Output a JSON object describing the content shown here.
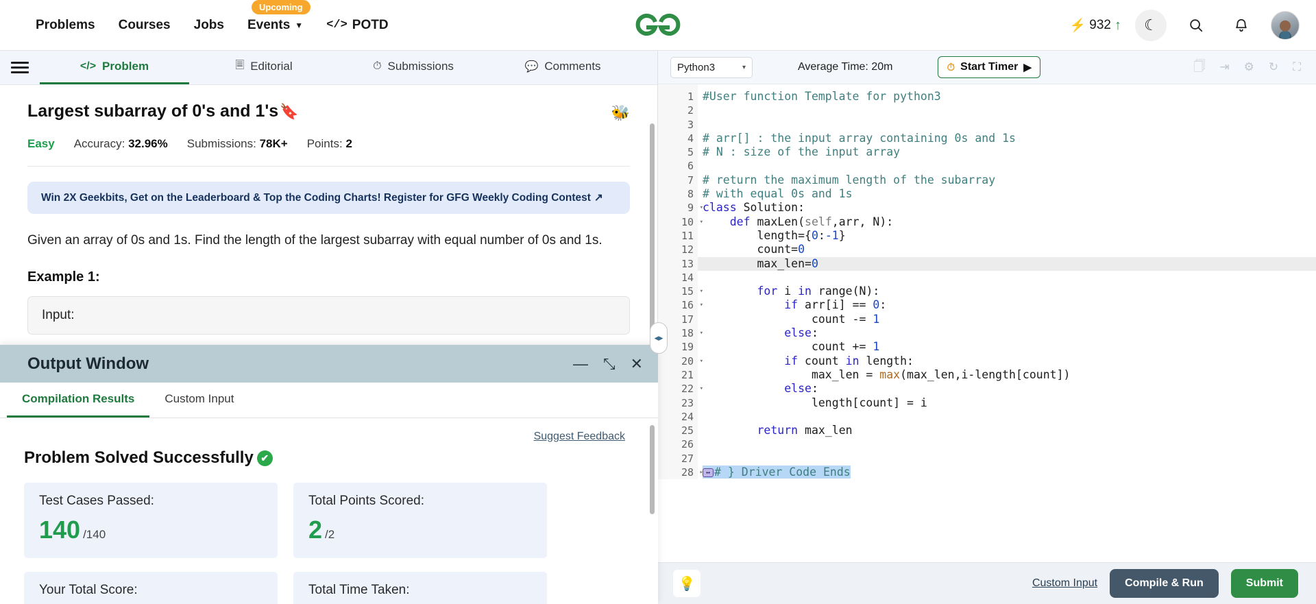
{
  "topnav": {
    "items": [
      {
        "label": "Problems",
        "has_chevron": false,
        "badge": null
      },
      {
        "label": "Courses",
        "has_chevron": false,
        "badge": null
      },
      {
        "label": "Jobs",
        "has_chevron": false,
        "badge": null
      },
      {
        "label": "Events",
        "has_chevron": true,
        "badge": "Upcoming"
      },
      {
        "label": "POTD",
        "has_chevron": false,
        "badge": null
      }
    ],
    "potd_icon": "</>",
    "logo": "gfg-logo",
    "streak_value": "932",
    "streak_icon": "bolt-icon",
    "streak_arrow": "↑",
    "dark_mode_icon": "☾",
    "search_icon": "search-icon",
    "bell_icon": "bell-icon",
    "avatar": "user-avatar"
  },
  "left": {
    "tabs": [
      {
        "label": "Problem",
        "icon": "</>",
        "active": true
      },
      {
        "label": "Editorial",
        "icon": "🗎",
        "active": false
      },
      {
        "label": "Submissions",
        "icon": "◴",
        "active": false
      },
      {
        "label": "Comments",
        "icon": "🗩",
        "active": false
      }
    ],
    "problem": {
      "title": "Largest subarray of 0's and 1's",
      "bookmark_icon": "🔖",
      "bug_icon": "bug-icon",
      "difficulty": "Easy",
      "accuracy_label": "Accuracy:",
      "accuracy_value": "32.96%",
      "submissions_label": "Submissions:",
      "submissions_value": "78K+",
      "points_label": "Points:",
      "points_value": "2",
      "promo_text": "Win 2X Geekbits, Get on the Leaderboard & Top the Coding Charts! Register for GFG Weekly Coding Contest",
      "promo_external_icon": "↗",
      "description": "Given an array of 0s and 1s. Find the length of the largest subarray with equal number of 0s and 1s.",
      "example_heading": "Example 1:",
      "example_input_label": "Input:"
    }
  },
  "output_window": {
    "title": "Output Window",
    "minimize_icon": "—",
    "expand_icon": "⤡",
    "close_icon": "✕",
    "tabs": [
      {
        "label": "Compilation Results",
        "active": true
      },
      {
        "label": "Custom Input",
        "active": false
      }
    ],
    "suggest_feedback": "Suggest Feedback",
    "status": "Problem Solved Successfully",
    "status_icon": "✔",
    "cards": [
      {
        "label": "Test Cases Passed:",
        "value": "140",
        "suffix": "/140"
      },
      {
        "label": "Total Points Scored:",
        "value": "2",
        "suffix": "/2"
      },
      {
        "label": "Your Total Score:",
        "value": "",
        "suffix": ""
      },
      {
        "label": "Total Time Taken:",
        "value": "",
        "suffix": ""
      }
    ]
  },
  "editor": {
    "language": "Python3",
    "language_chevron": "▾",
    "average_time": "Average Time: 20m",
    "timer_label": "Start Timer",
    "timer_clock_icon": "⏱",
    "timer_play_icon": "▶",
    "toolbar_icons": [
      "copy-icon",
      "sign-in-icon",
      "gear-icon",
      "reset-icon",
      "fullscreen-icon"
    ],
    "lines": [
      {
        "n": 1,
        "fold": "",
        "hl": false,
        "tokens": [
          {
            "t": "#User function Template for python3",
            "c": "com"
          }
        ]
      },
      {
        "n": 2,
        "fold": "",
        "hl": false,
        "tokens": []
      },
      {
        "n": 3,
        "fold": "",
        "hl": false,
        "tokens": []
      },
      {
        "n": 4,
        "fold": "",
        "hl": false,
        "tokens": [
          {
            "t": "# arr[] : the input array containing 0s and 1s",
            "c": "com"
          }
        ]
      },
      {
        "n": 5,
        "fold": "",
        "hl": false,
        "tokens": [
          {
            "t": "# N : size of the input array",
            "c": "com"
          }
        ]
      },
      {
        "n": 6,
        "fold": "",
        "hl": false,
        "tokens": []
      },
      {
        "n": 7,
        "fold": "",
        "hl": false,
        "tokens": [
          {
            "t": "# return the maximum length of the subarray",
            "c": "com"
          }
        ]
      },
      {
        "n": 8,
        "fold": "",
        "hl": false,
        "tokens": [
          {
            "t": "# with equal 0s and 1s",
            "c": "com"
          }
        ]
      },
      {
        "n": 9,
        "fold": "▾",
        "hl": false,
        "tokens": [
          {
            "t": "class",
            "c": "kw"
          },
          {
            "t": " Solution:",
            "c": "plain"
          }
        ]
      },
      {
        "n": 10,
        "fold": "▾",
        "hl": false,
        "tokens": [
          {
            "t": "    ",
            "c": "plain"
          },
          {
            "t": "def",
            "c": "kw"
          },
          {
            "t": " maxLen(",
            "c": "plain"
          },
          {
            "t": "self",
            "c": "self"
          },
          {
            "t": ",arr, N):",
            "c": "plain"
          }
        ]
      },
      {
        "n": 11,
        "fold": "",
        "hl": false,
        "tokens": [
          {
            "t": "        length={",
            "c": "plain"
          },
          {
            "t": "0",
            "c": "num"
          },
          {
            "t": ":",
            "c": "plain"
          },
          {
            "t": "-1",
            "c": "num"
          },
          {
            "t": "}",
            "c": "plain"
          }
        ]
      },
      {
        "n": 12,
        "fold": "",
        "hl": false,
        "tokens": [
          {
            "t": "        count=",
            "c": "plain"
          },
          {
            "t": "0",
            "c": "num"
          }
        ]
      },
      {
        "n": 13,
        "fold": "",
        "hl": true,
        "tokens": [
          {
            "t": "        max_len=",
            "c": "plain"
          },
          {
            "t": "0",
            "c": "num"
          }
        ]
      },
      {
        "n": 14,
        "fold": "",
        "hl": false,
        "tokens": []
      },
      {
        "n": 15,
        "fold": "▾",
        "hl": false,
        "tokens": [
          {
            "t": "        ",
            "c": "plain"
          },
          {
            "t": "for",
            "c": "kw"
          },
          {
            "t": " i ",
            "c": "plain"
          },
          {
            "t": "in",
            "c": "kw"
          },
          {
            "t": " range(N):",
            "c": "plain"
          }
        ]
      },
      {
        "n": 16,
        "fold": "▾",
        "hl": false,
        "tokens": [
          {
            "t": "            ",
            "c": "plain"
          },
          {
            "t": "if",
            "c": "kw"
          },
          {
            "t": " arr[i] == ",
            "c": "plain"
          },
          {
            "t": "0",
            "c": "num"
          },
          {
            "t": ":",
            "c": "plain"
          }
        ]
      },
      {
        "n": 17,
        "fold": "",
        "hl": false,
        "tokens": [
          {
            "t": "                count -= ",
            "c": "plain"
          },
          {
            "t": "1",
            "c": "num"
          }
        ]
      },
      {
        "n": 18,
        "fold": "▾",
        "hl": false,
        "tokens": [
          {
            "t": "            ",
            "c": "plain"
          },
          {
            "t": "else",
            "c": "kw"
          },
          {
            "t": ":",
            "c": "plain"
          }
        ]
      },
      {
        "n": 19,
        "fold": "",
        "hl": false,
        "tokens": [
          {
            "t": "                count += ",
            "c": "plain"
          },
          {
            "t": "1",
            "c": "num"
          }
        ]
      },
      {
        "n": 20,
        "fold": "▾",
        "hl": false,
        "tokens": [
          {
            "t": "            ",
            "c": "plain"
          },
          {
            "t": "if",
            "c": "kw"
          },
          {
            "t": " count ",
            "c": "plain"
          },
          {
            "t": "in",
            "c": "kw"
          },
          {
            "t": " length:",
            "c": "plain"
          }
        ]
      },
      {
        "n": 21,
        "fold": "",
        "hl": false,
        "tokens": [
          {
            "t": "                max_len = ",
            "c": "plain"
          },
          {
            "t": "max",
            "c": "builtin"
          },
          {
            "t": "(max_len,i-length[count])",
            "c": "plain"
          }
        ]
      },
      {
        "n": 22,
        "fold": "▾",
        "hl": false,
        "tokens": [
          {
            "t": "            ",
            "c": "plain"
          },
          {
            "t": "else",
            "c": "kw"
          },
          {
            "t": ":",
            "c": "plain"
          }
        ]
      },
      {
        "n": 23,
        "fold": "",
        "hl": false,
        "tokens": [
          {
            "t": "                length[count] = i",
            "c": "plain"
          }
        ]
      },
      {
        "n": 24,
        "fold": "",
        "hl": false,
        "tokens": []
      },
      {
        "n": 25,
        "fold": "",
        "hl": false,
        "tokens": [
          {
            "t": "        ",
            "c": "plain"
          },
          {
            "t": "return",
            "c": "kw"
          },
          {
            "t": " max_len",
            "c": "plain"
          }
        ]
      },
      {
        "n": 26,
        "fold": "",
        "hl": false,
        "tokens": []
      },
      {
        "n": 27,
        "fold": "",
        "hl": false,
        "tokens": []
      },
      {
        "n": 28,
        "fold": "▸",
        "hl": false,
        "folded_chip": "↔",
        "sel": true,
        "tokens": [
          {
            "t": "# } Driver Code Ends",
            "c": "com"
          }
        ]
      }
    ],
    "footer": {
      "bulb_icon": "💡",
      "custom_input": "Custom Input",
      "compile_run": "Compile & Run",
      "submit": "Submit"
    }
  },
  "colors": {
    "brand_green": "#2f8d46",
    "accent_orange": "#f7a72c",
    "promo_bg": "#e3ebfb",
    "output_header_bg": "#b9ccd3",
    "dark_button": "#44586a"
  }
}
